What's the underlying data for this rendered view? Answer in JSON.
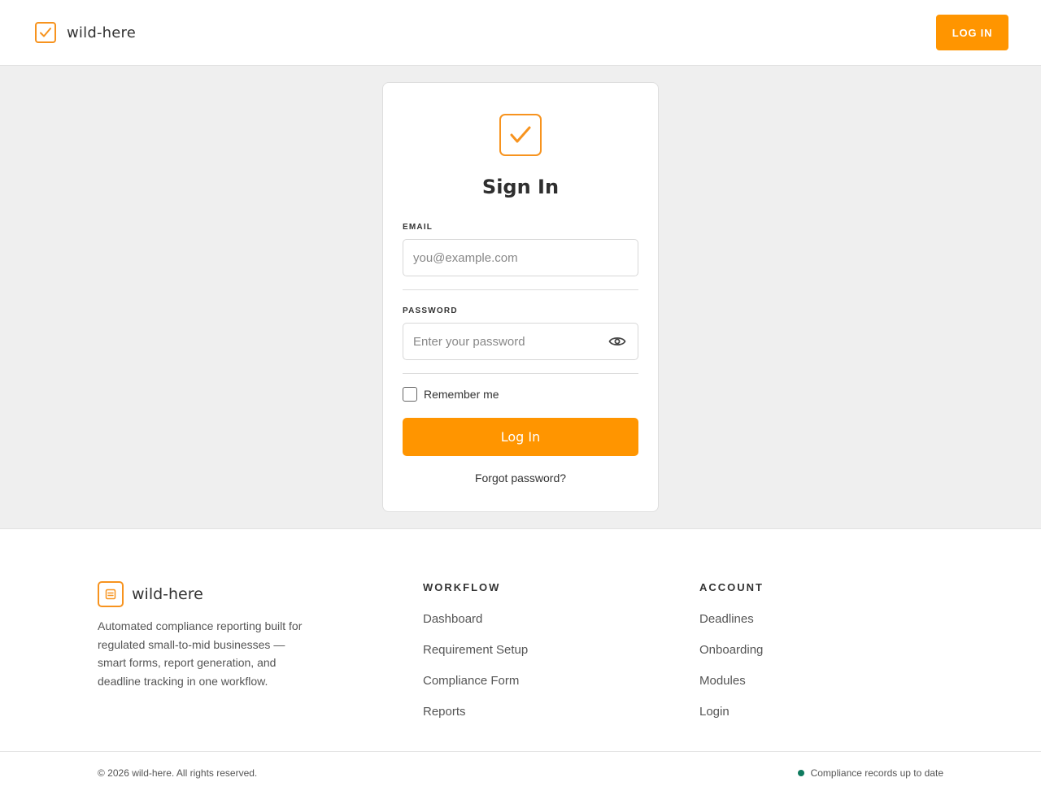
{
  "header": {
    "brand": "wild-here",
    "login_label": "LOG IN"
  },
  "signin": {
    "title": "Sign In",
    "email_label": "EMAIL",
    "email_placeholder": "you@example.com",
    "email_value": "",
    "password_label": "PASSWORD",
    "password_placeholder": "Enter your password",
    "password_value": "",
    "remember_label": "Remember me",
    "remember_checked": false,
    "submit_label": "Log In",
    "forgot_label": "Forgot password?"
  },
  "footer": {
    "brand": "wild-here",
    "description": "Automated compliance reporting built for regulated small-to-mid businesses — smart forms, report generation, and deadline tracking in one workflow.",
    "columns": [
      {
        "title": "WORKFLOW",
        "links": [
          "Dashboard",
          "Requirement Setup",
          "Compliance Form",
          "Reports"
        ]
      },
      {
        "title": "ACCOUNT",
        "links": [
          "Deadlines",
          "Onboarding",
          "Modules",
          "Login"
        ]
      }
    ],
    "copyright": "© 2026 wild-here. All rights reserved.",
    "status_text": "Compliance records up to date"
  },
  "colors": {
    "accent": "#ff9500",
    "status_ok": "#0f7b5f"
  },
  "icons": {
    "brand": "checkbox-check-icon",
    "footer_brand": "document-icon",
    "password_toggle": "eye-icon"
  }
}
